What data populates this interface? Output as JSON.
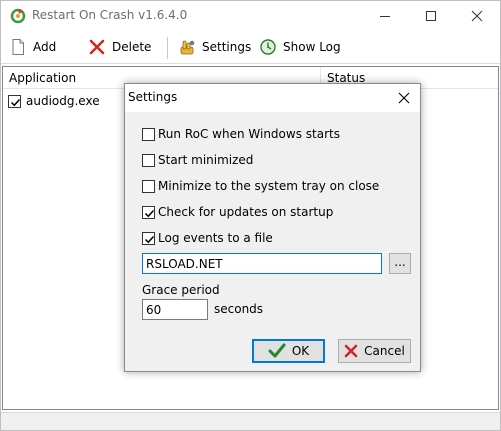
{
  "window": {
    "title": "Restart On Crash v1.6.4.0"
  },
  "toolbar": {
    "add_label": "Add",
    "delete_label": "Delete",
    "settings_label": "Settings",
    "showlog_label": "Show Log"
  },
  "listview": {
    "columns": [
      "Application",
      "Status"
    ],
    "rows": [
      {
        "checked": true,
        "application": "audiodg.exe",
        "status": ""
      }
    ]
  },
  "dialog": {
    "title": "Settings",
    "options": [
      {
        "label": "Run RoC when Windows starts",
        "checked": false
      },
      {
        "label": "Start minimized",
        "checked": false
      },
      {
        "label": "Minimize to the system tray on close",
        "checked": false
      },
      {
        "label": "Check for updates on startup",
        "checked": true
      },
      {
        "label": "Log events to a file",
        "checked": true
      }
    ],
    "log_file_value": "RSLOAD.NET",
    "browse_label": "...",
    "grace_period_label": "Grace period",
    "grace_period_value": "60",
    "seconds_label": "seconds",
    "ok_label": "OK",
    "cancel_label": "Cancel"
  },
  "icons": {
    "app": "restart-app-icon",
    "add": "document-icon",
    "delete": "red-x-icon",
    "settings": "settings-hand-icon",
    "showlog": "log-clock-icon",
    "ok": "green-check-icon",
    "cancel": "red-x-icon"
  }
}
